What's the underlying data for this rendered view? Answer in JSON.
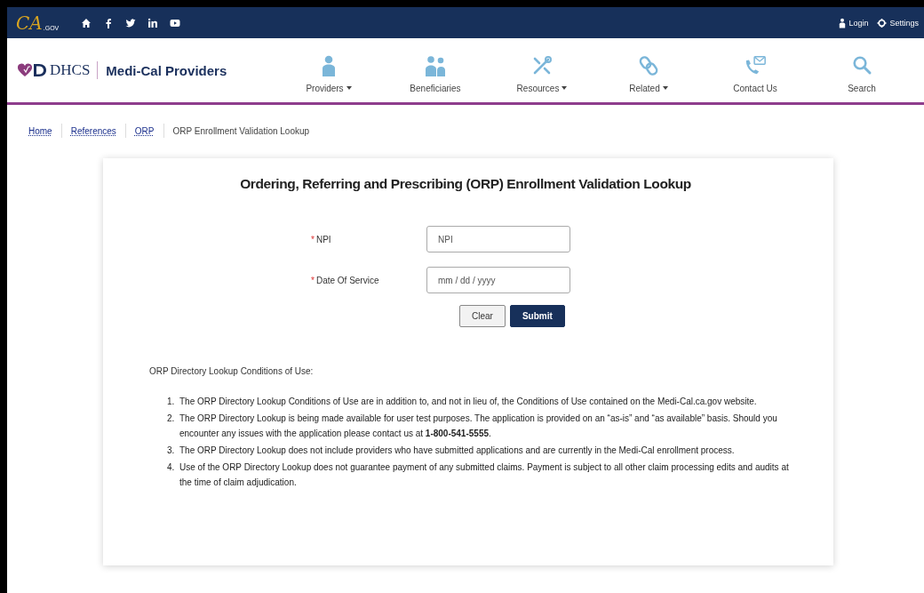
{
  "top_bar": {
    "logo": {
      "mark": "CA",
      "suffix": ".GOV"
    },
    "social": [
      {
        "kind": "home"
      },
      {
        "kind": "facebook"
      },
      {
        "kind": "twitter"
      },
      {
        "kind": "linkedin"
      },
      {
        "kind": "youtube"
      }
    ],
    "links": [
      {
        "kind": "user",
        "label": "Login"
      },
      {
        "kind": "gear",
        "label": "Settings"
      }
    ]
  },
  "header": {
    "brand": {
      "org": "DHCS",
      "site": "Medi-Cal Providers"
    },
    "nav": [
      {
        "kind": "person",
        "label": "Providers",
        "dropdown": true
      },
      {
        "kind": "people",
        "label": "Beneficiaries",
        "dropdown": false
      },
      {
        "kind": "tools",
        "label": "Resources",
        "dropdown": true
      },
      {
        "kind": "link",
        "label": "Related",
        "dropdown": true
      },
      {
        "kind": "phone",
        "label": "Contact Us",
        "dropdown": false
      },
      {
        "kind": "search",
        "label": "Search",
        "dropdown": false
      }
    ]
  },
  "breadcrumb": [
    {
      "label": "Home",
      "link": true
    },
    {
      "label": "References",
      "link": true
    },
    {
      "label": "ORP",
      "link": true
    },
    {
      "label": "ORP Enrollment Validation Lookup",
      "link": false
    }
  ],
  "form": {
    "title": "Ordering, Referring and Prescribing (ORP) Enrollment Validation Lookup",
    "fields": [
      {
        "label": "NPI",
        "required_mark": "*",
        "placeholder": "NPI"
      },
      {
        "label": "Date Of Service",
        "required_mark": "*",
        "placeholder": "mm / dd / yyyy"
      }
    ],
    "buttons": [
      {
        "kind": "secondary",
        "label": "Clear"
      },
      {
        "kind": "primary",
        "label": "Submit"
      }
    ]
  },
  "conditions": {
    "heading": "ORP Directory Lookup Conditions of Use:",
    "items": [
      {
        "number": "1.",
        "text": "The ORP Directory Lookup Conditions of Use are in addition to, and not in lieu of, the Conditions of Use contained on the Medi-Cal.ca.gov website."
      },
      {
        "number": "2.",
        "text": "The ORP Directory Lookup is being made available for user test purposes. The application is provided on an “as-is” and “as available” basis. Should you encounter any issues with the application please contact us at **1-800-541-5555**."
      },
      {
        "number": "3.",
        "text": "The ORP Directory Lookup does not include providers who have submitted applications and are currently in the Medi-Cal enrollment process."
      },
      {
        "number": "4.",
        "text": "Use of the ORP Directory Lookup does not guarantee payment of any submitted claims. Payment is subject to all other claim processing edits and audits at the time of claim adjudication."
      }
    ]
  }
}
